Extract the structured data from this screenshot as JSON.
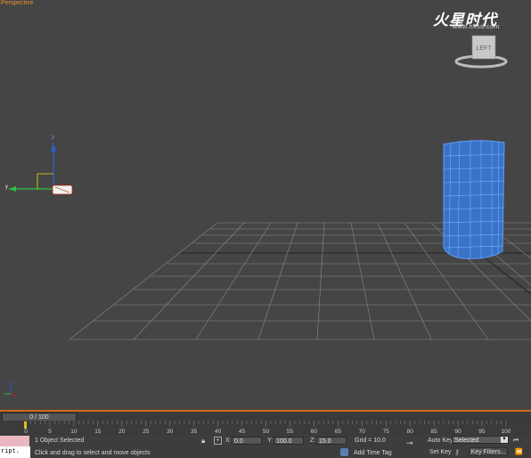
{
  "viewport": {
    "label": "Perspective",
    "viewcube_label": "LEFT",
    "logo_text": "火星时代",
    "logo_url": "www.hxsd.com",
    "axis": {
      "x": "x",
      "y": "y",
      "z": "z"
    }
  },
  "timeline": {
    "slider_text": "0 / 100",
    "ticks": [
      "0",
      "5",
      "10",
      "15",
      "20",
      "25",
      "30",
      "35",
      "40",
      "45",
      "50",
      "55",
      "60",
      "65",
      "70",
      "75",
      "80",
      "85",
      "90",
      "95",
      "100"
    ]
  },
  "status": {
    "selection": "1 Object Selected",
    "prompt": "Click and drag to select and move objects",
    "x_label": "X:",
    "x_value": "0.0",
    "y_label": "Y:",
    "y_value": "100.0",
    "z_label": "Z:",
    "z_value": "15.0",
    "grid": "Grid = 10.0",
    "add_time_tag": "Add Time Tag",
    "auto_key": "Auto Key",
    "selected_option": "Selected",
    "set_key": "Set Key",
    "key_filters": "Key Filters...",
    "script_text": "ript."
  }
}
